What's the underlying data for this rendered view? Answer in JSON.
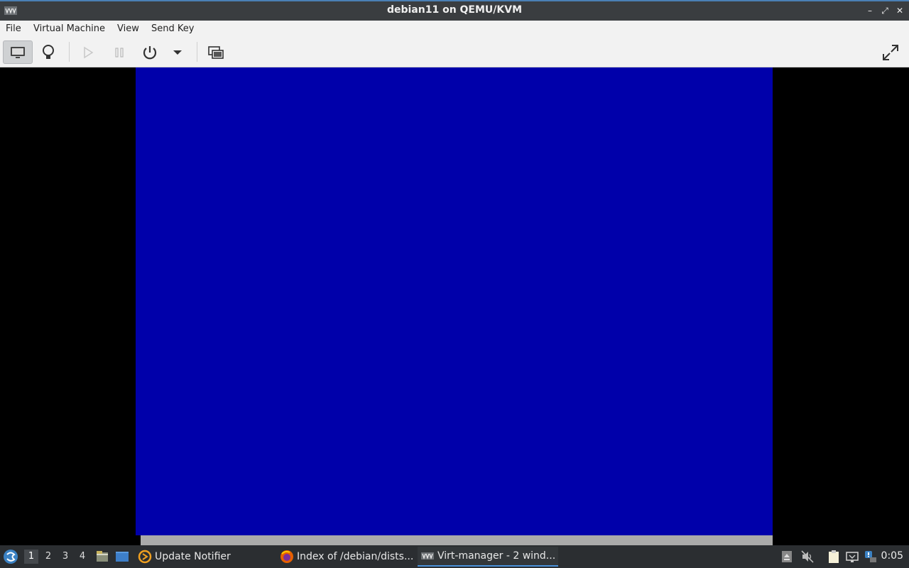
{
  "window": {
    "title": "debian11 on QEMU/KVM",
    "app_icon": "virt-manager-icon",
    "controls": [
      "minimize-icon",
      "maximize-icon",
      "close-icon"
    ]
  },
  "menubar": {
    "items": [
      "File",
      "Virtual Machine",
      "View",
      "Send Key"
    ]
  },
  "toolbar": {
    "buttons": [
      {
        "icon": "monitor-icon",
        "active": true
      },
      {
        "icon": "lightbulb-icon",
        "active": false
      },
      {
        "icon": "play-icon",
        "enabled": false
      },
      {
        "icon": "pause-icon",
        "enabled": false
      },
      {
        "icon": "power-icon",
        "enabled": true
      },
      {
        "icon": "chevron-down-icon",
        "enabled": true
      },
      {
        "icon": "snapshots-icon",
        "enabled": true
      },
      {
        "icon": "fullscreen-icon",
        "enabled": true
      }
    ]
  },
  "vm": {
    "screen_color": "#0000aa",
    "bar_color": "#aaaaaa"
  },
  "taskbar": {
    "workspaces": [
      "1",
      "2",
      "3",
      "4"
    ],
    "active_workspace": "1",
    "tasks": [
      {
        "label": "Update Notifier",
        "icon": "update-notifier-icon"
      },
      {
        "label": "Index of /debian/dists...",
        "icon": "firefox-icon"
      },
      {
        "label": "Virt-manager - 2 wind...",
        "icon": "virt-manager-icon",
        "active": true
      }
    ],
    "clock": "0:05"
  },
  "colors": {
    "titlebar": "#3a3d40",
    "accent": "#4a7fb5",
    "taskbar": "#2b2e31"
  }
}
